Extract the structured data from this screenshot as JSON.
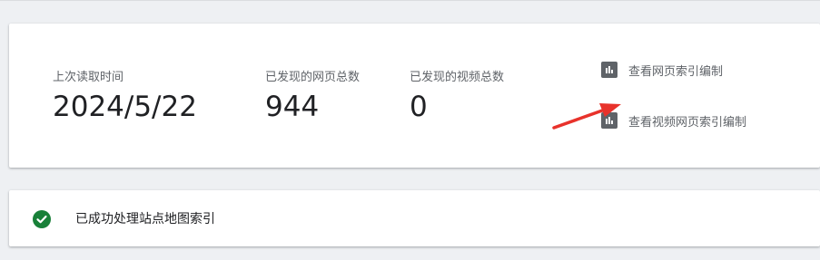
{
  "stats": [
    {
      "label": "上次读取时间",
      "value": "2024/5/22"
    },
    {
      "label": "已发现的网页总数",
      "value": "944"
    },
    {
      "label": "已发现的视频总数",
      "value": "0"
    }
  ],
  "links": {
    "page_index": {
      "label": "查看网页索引编制",
      "icon": "bar-chart-icon"
    },
    "video_index": {
      "label": "查看视频网页索引编制",
      "icon": "bar-chart-icon"
    }
  },
  "status": {
    "text": "已成功处理站点地图索引",
    "icon": "check-circle-icon",
    "color": "#188038"
  },
  "colors": {
    "arrow": "#e8322b",
    "icon_bg": "#5f6368"
  }
}
